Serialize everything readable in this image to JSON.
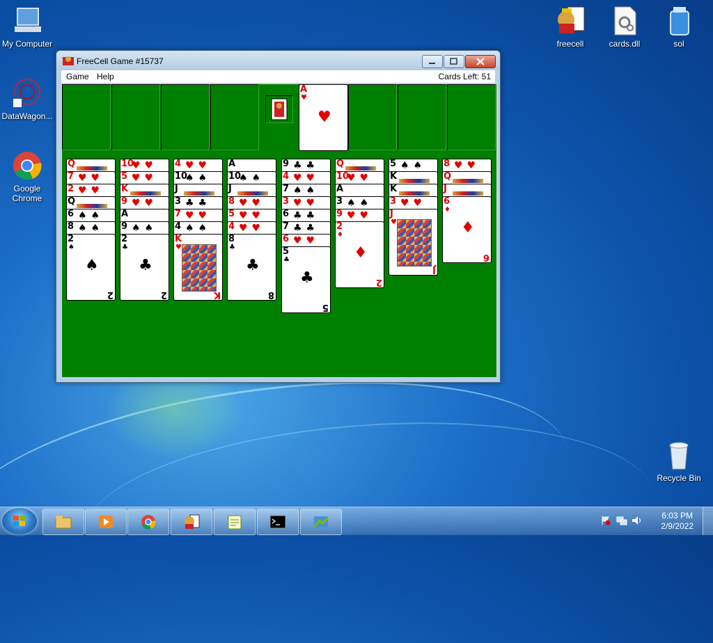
{
  "desktop": {
    "icons_left": [
      {
        "label": "My Computer",
        "icon": "computer-icon"
      },
      {
        "label": "DataWagon...",
        "icon": "datawagon-icon"
      },
      {
        "label": "Google Chrome",
        "icon": "chrome-icon"
      }
    ],
    "icons_right": [
      {
        "label": "freecell",
        "icon": "freecell-icon"
      },
      {
        "label": "cards.dll",
        "icon": "dll-file-icon"
      },
      {
        "label": "sol",
        "icon": "sol-icon"
      }
    ],
    "recycle_bin": {
      "label": "Recycle Bin",
      "icon": "recycle-bin-icon"
    }
  },
  "window": {
    "title": "FreeCell Game #15737",
    "menu": [
      "Game",
      "Help"
    ],
    "cards_left": "Cards Left: 51"
  },
  "foundations": [
    {
      "rank": "A",
      "suit": "♥",
      "color": "red"
    }
  ],
  "columns": [
    [
      "Q♥",
      "7♥",
      "2♥",
      "Q♣",
      "6♠",
      "8♠",
      "2♠"
    ],
    [
      "10♥",
      "5♥",
      "K♥",
      "9♥",
      "A♠",
      "9♠",
      "2♣"
    ],
    [
      "4♥",
      "10♠",
      "J♣",
      "3♣",
      "7♥",
      "4♠",
      "K♥"
    ],
    [
      "A♠",
      "10♠",
      "J♠",
      "8♥",
      "5♥",
      "4♥",
      "8♣"
    ],
    [
      "9♣",
      "4♥",
      "7♠",
      "3♥",
      "6♣",
      "7♣",
      "6♥",
      "5♣"
    ],
    [
      "Q♥",
      "10♥",
      "A♠",
      "3♠",
      "9♥",
      "2♦"
    ],
    [
      "5♠",
      "K♠",
      "K♠",
      "3♥",
      "J♥"
    ],
    [
      "8♥",
      "Q♥",
      "J♥",
      "6♦"
    ]
  ],
  "taskbar": {
    "buttons": [
      "file-explorer-icon",
      "media-player-icon",
      "chrome-icon",
      "freecell-icon",
      "notepad-icon",
      "cmd-icon",
      "control-panel-icon"
    ],
    "time": "6:03 PM",
    "date": "2/9/2022"
  }
}
